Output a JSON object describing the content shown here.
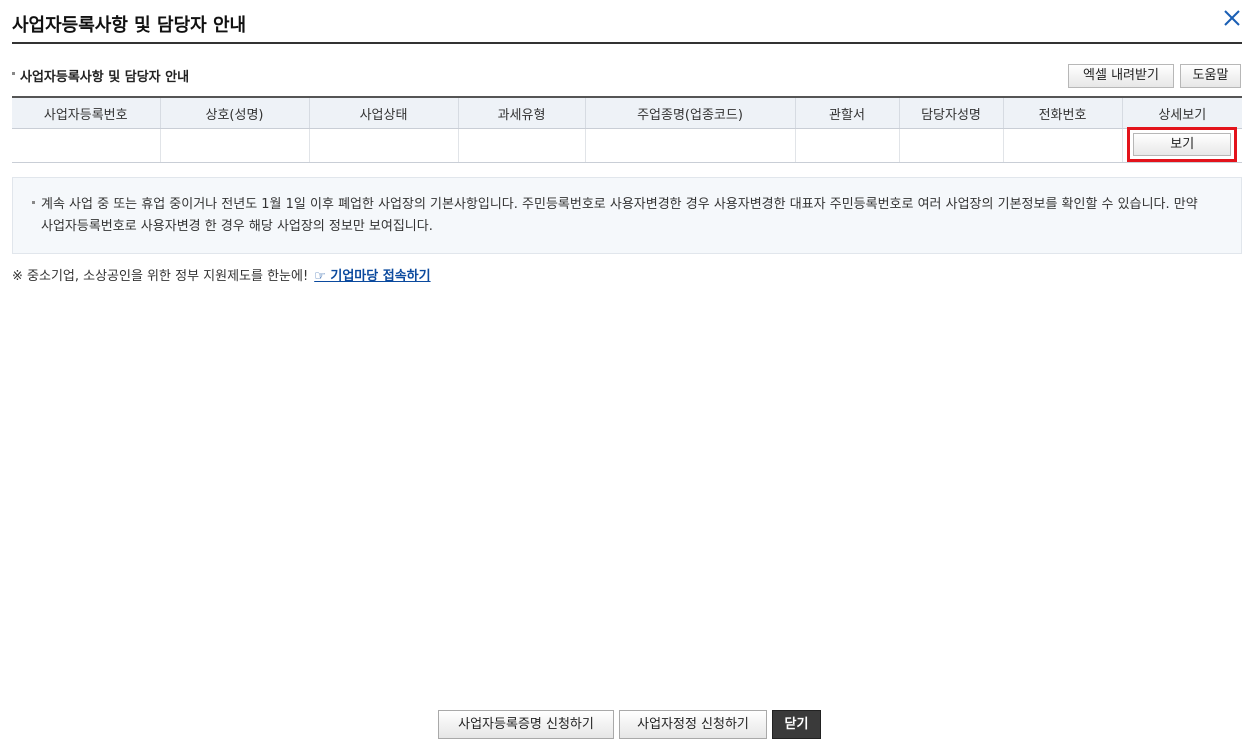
{
  "dialog": {
    "title": "사업자등록사항 및 담당자 안내"
  },
  "section": {
    "title": "사업자등록사항 및 담당자 안내",
    "excel_button": "엑셀 내려받기",
    "help_button": "도움말"
  },
  "table": {
    "headers": [
      "사업자등록번호",
      "상호(성명)",
      "사업상태",
      "과세유형",
      "주업종명(업종코드)",
      "관할서",
      "담당자성명",
      "전화번호",
      "상세보기"
    ],
    "rows": [
      {
        "view_button": "보기"
      }
    ]
  },
  "notice": {
    "text": "계속 사업 중 또는 휴업 중이거나 전년도 1월 1일 이후 폐업한 사업장의 기본사항입니다. 주민등록번호로 사용자변경한 경우 사용자변경한 대표자 주민등록번호로 여러 사업장의 기본정보를 확인할 수 있습니다. 만약 사업자등록번호로 사용자변경 한 경우 해당 사업장의 정보만 보여집니다."
  },
  "promo": {
    "text": "※ 중소기업, 소상공인을 위한 정부 지원제도를 한눈에!",
    "link": "☞ 기업마당 접속하기"
  },
  "footer": {
    "btn_certificate": "사업자등록증명 신청하기",
    "btn_correction": "사업자정정 신청하기",
    "btn_close": "닫기"
  },
  "colors": {
    "highlight": "#e3131b",
    "link": "#0b4a9e",
    "close_icon": "#1a5fb4"
  }
}
